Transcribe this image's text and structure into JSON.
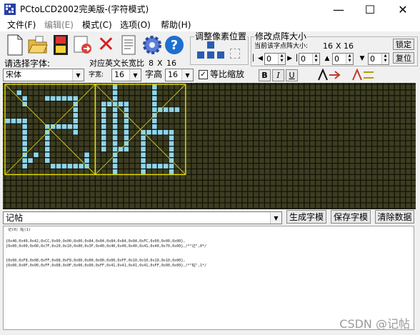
{
  "window": {
    "title": "PCtoLCD2002完美版-(字符模式)",
    "minimize_glyph": "—",
    "maximize_glyph": "☐",
    "close_glyph": "✕"
  },
  "menu": [
    {
      "label": "文件(F)",
      "enabled": true
    },
    {
      "label": "编辑(E)",
      "enabled": false
    },
    {
      "label": "模式(C)",
      "enabled": true
    },
    {
      "label": "选项(O)",
      "enabled": true
    },
    {
      "label": "帮助(H)",
      "enabled": true
    }
  ],
  "toolbar": {
    "icons": [
      "new-file-icon",
      "open-folder-icon",
      "save-icon",
      "convert-icon",
      "delete-icon",
      "document-icon",
      "settings-gear-icon",
      "help-icon"
    ],
    "help_glyph": "?",
    "delete_glyph": "✕"
  },
  "pixel_adjust": {
    "label": "调整像素位置"
  },
  "dot_matrix": {
    "label": "修改点阵大小",
    "current_label": "当前该字点阵大小:",
    "current_w": "16",
    "sep": "X",
    "current_h": "16",
    "lock_button": "锁定",
    "restore_button": "复位",
    "spin_values": [
      "0",
      "0",
      "0",
      "0"
    ]
  },
  "font": {
    "label": "请选择字体:",
    "name": "宋体",
    "ascii_label": "对应英文长宽比",
    "ascii_w": "8",
    "ascii_sep": "X",
    "ascii_h": "16",
    "width_label": "字宽:",
    "width_value": "16",
    "height_label": "字高",
    "height_value": "16",
    "proportional_label": "等比缩放",
    "proportional_checked": true,
    "bold_label": "B",
    "italic_label": "I",
    "underline_label": "U"
  },
  "editor": {
    "text": "记帖",
    "generate_button": "生成字模",
    "save_button": "保存字模",
    "clear_button": "清除数据"
  },
  "output": {
    "lines": [
      " 记(0) 帖(1)",
      "",
      "{0x40,0x40,0x42,0xCC,0x00,0x00,0x00,0x84,0x84,0x84,0x84,0x84,0xFC,0x00,0x00,0x00},",
      "{0x00,0x00,0x00,0x7F,0x20,0x10,0x00,0x3F,0x40,0x40,0x40,0x40,0x41,0x40,0x70,0x00},/*\"记\",0*/",
      "",
      "{0x00,0xF8,0x08,0xFF,0x08,0xF8,0x00,0x00,0x00,0x00,0xFF,0x10,0x10,0x10,0x10,0x00},",
      "{0x00,0x0F,0x00,0xFF,0x08,0x0F,0x00,0x00,0xFF,0x41,0x41,0x41,0x41,0xFF,0x00,0x00},/*\"帖\",1*/"
    ]
  },
  "watermark": "CSDN @记帖",
  "colors": {
    "grid_bg": "#3d3d22",
    "grid_line": "#141408",
    "pixel_on": "#8fd6ec",
    "box_line": "#e6e000",
    "help_blue": "#1f6fd0"
  }
}
